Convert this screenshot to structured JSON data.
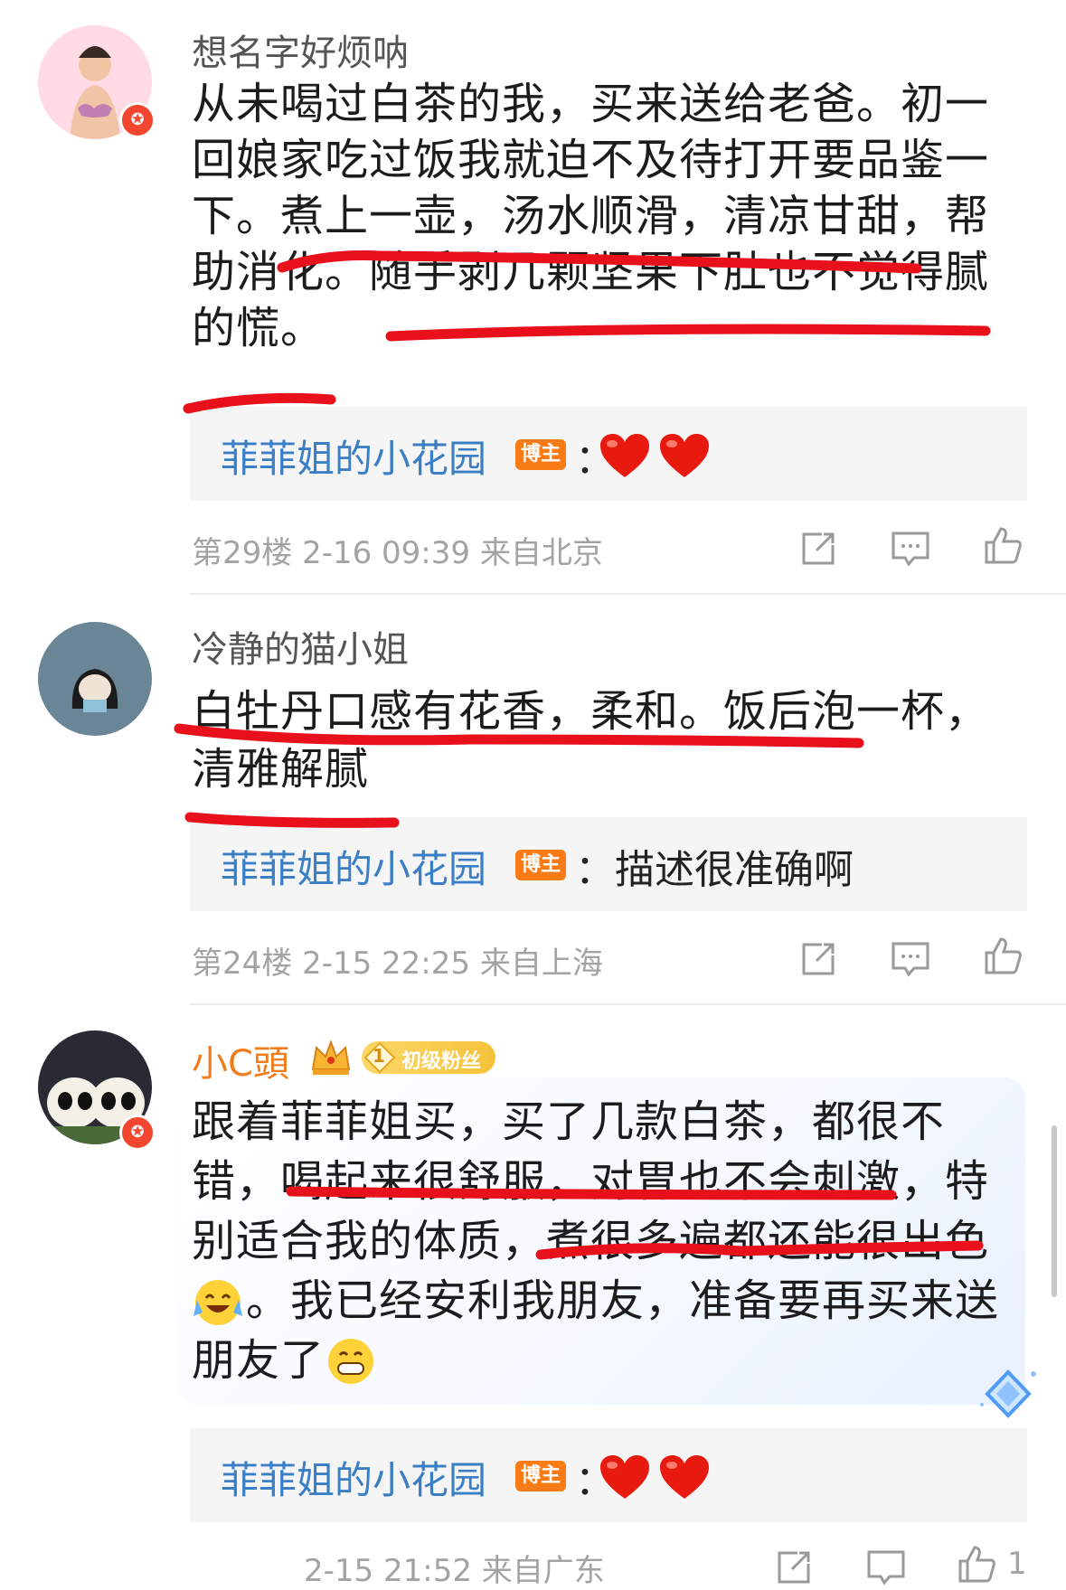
{
  "comments": [
    {
      "username": "想名字好烦呐",
      "lines": [
        "从未喝过白茶的我，买来送给老爸。初一",
        "回娘家吃过饭我就迫不及待打开要品鉴一",
        "下。煮上一壶，汤水顺滑，清凉甘甜，帮",
        "助消化。随手剥几颗坚果下肚也不觉得腻",
        "的慌。"
      ],
      "reply": {
        "name": "菲菲姐的小花园",
        "badge": "博主",
        "text": "："
      },
      "meta": "第29楼 2-16 09:39 来自北京"
    },
    {
      "username": "冷静的猫小姐",
      "lines": [
        "白牡丹口感有花香，柔和。饭后泡一杯，",
        "清雅解腻"
      ],
      "reply": {
        "name": "菲菲姐的小花园",
        "badge": "博主",
        "text": "：描述很准确啊"
      },
      "meta": "第24楼 2-15 22:25 来自上海"
    },
    {
      "username": "小C頭",
      "fan_badge": "初级粉丝",
      "fan_level": "1",
      "lines": [
        "跟着菲菲姐买，买了几款白茶，都很不",
        "错，喝起来很舒服，对胃也不会刺激，特",
        "别适合我的体质，煮很多遍都还能很出色",
        "。我已经安利我朋友，准备要再买来送",
        "朋友了"
      ],
      "reply": {
        "name": "菲菲姐的小花园",
        "badge": "博主",
        "text": "："
      },
      "meta": "2-15 21:52 来自广东",
      "like_count": "1"
    }
  ],
  "colors": {
    "accent_blue": "#3a7fc6",
    "username_orange": "#f07c1c",
    "underline_red": "#e8101a",
    "badge_orange": "#f97b16"
  },
  "icons": [
    "share-icon",
    "comment-icon",
    "like-icon",
    "heart-icon",
    "crown-icon",
    "diamond-icon"
  ]
}
